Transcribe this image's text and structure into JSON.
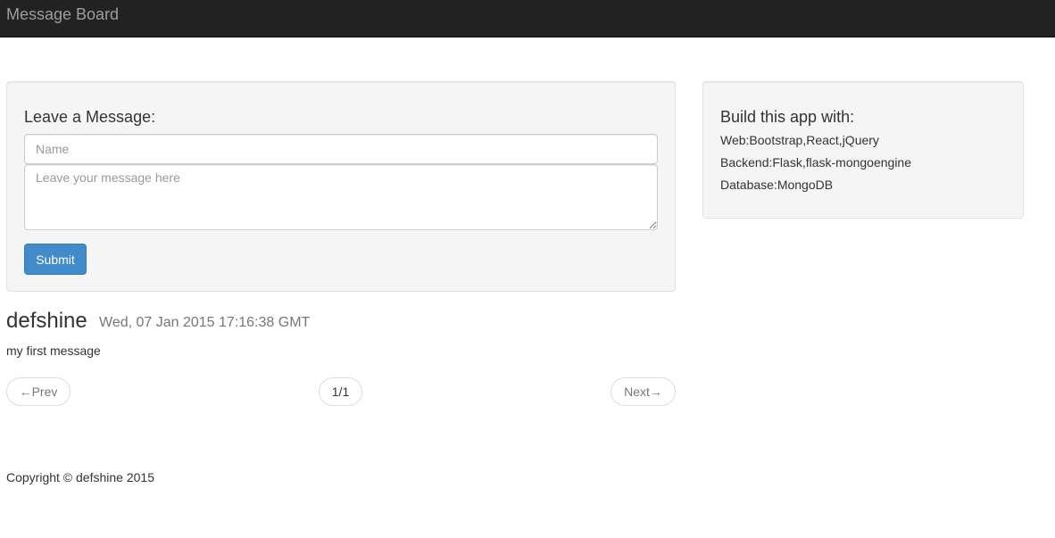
{
  "navbar": {
    "brand": "Message Board"
  },
  "form": {
    "heading": "Leave a Message:",
    "name_placeholder": "Name",
    "name_value": "",
    "message_placeholder": "Leave your message here",
    "message_value": "",
    "submit_label": "Submit"
  },
  "info": {
    "heading": "Build this app with:",
    "lines": [
      "Web:Bootstrap,React,jQuery",
      "Backend:Flask,flask-mongoengine",
      "Database:MongoDB"
    ]
  },
  "messages": [
    {
      "author": "defshine",
      "date": "Wed, 07 Jan 2015 17:16:38 GMT",
      "body": "my first message"
    }
  ],
  "pager": {
    "prev_label": "←Prev",
    "page_label": "1/1",
    "next_label": "Next→"
  },
  "footer": {
    "copyright": "Copyright © defshine 2015"
  }
}
